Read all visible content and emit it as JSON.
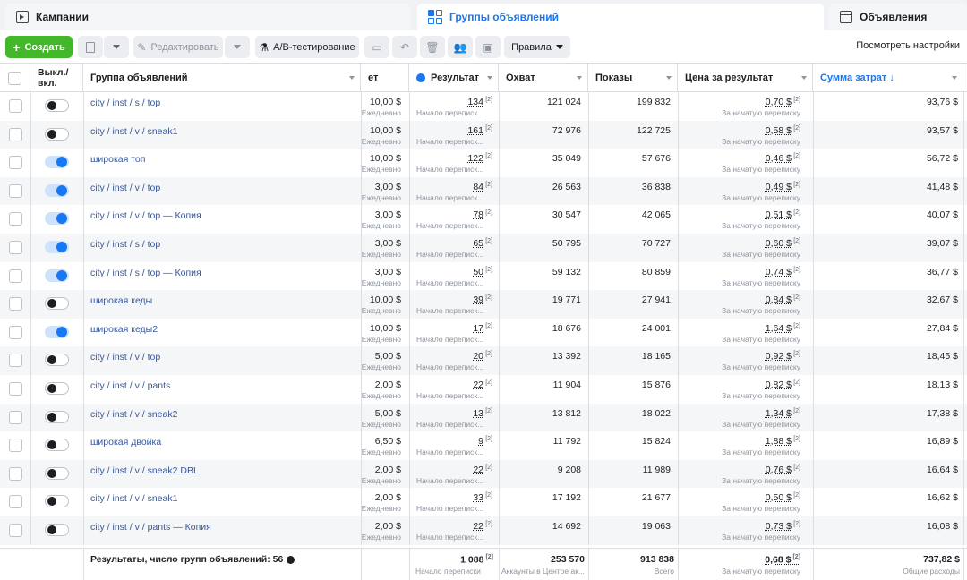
{
  "tabs": [
    {
      "label": "Кампании"
    },
    {
      "label": "Группы объявлений"
    },
    {
      "label": "Объявления"
    }
  ],
  "toolbar": {
    "create_label": "Создать",
    "edit_label": "Редактировать",
    "ab_label": "A/B-тестирование",
    "rules_label": "Правила",
    "settings_label": "Посмотреть настройки"
  },
  "columns": {
    "toggle": "Выкл./ вкл.",
    "name": "Группа объявлений",
    "budget": "ет",
    "result": "Результат",
    "reach": "Охват",
    "impressions": "Показы",
    "cost_per_result": "Цена за результат",
    "spend": "Сумма затрат ↓"
  },
  "rows": [
    {
      "on": false,
      "name": "city / inst / s / top",
      "budget": "10,00 $",
      "budget_sub": "Ежедневно",
      "result": "134",
      "result_sub": "Начало переписк...",
      "reach": "121 024",
      "impressions": "199 832",
      "cpr": "0,70 $",
      "cpr_sub": "За начатую переписку",
      "spend": "93,76 $"
    },
    {
      "on": false,
      "name": "city / inst / v / sneak1",
      "budget": "10,00 $",
      "budget_sub": "Ежедневно",
      "result": "161",
      "result_sub": "Начало переписк...",
      "reach": "72 976",
      "impressions": "122 725",
      "cpr": "0,58 $",
      "cpr_sub": "За начатую переписку",
      "spend": "93,57 $"
    },
    {
      "on": true,
      "name": "широкая топ",
      "budget": "10,00 $",
      "budget_sub": "Ежедневно",
      "result": "122",
      "result_sub": "Начало переписк...",
      "reach": "35 049",
      "impressions": "57 676",
      "cpr": "0,46 $",
      "cpr_sub": "За начатую переписку",
      "spend": "56,72 $"
    },
    {
      "on": true,
      "name": "city / inst / v / top",
      "budget": "3,00 $",
      "budget_sub": "Ежедневно",
      "result": "84",
      "result_sub": "Начало переписк...",
      "reach": "26 563",
      "impressions": "36 838",
      "cpr": "0,49 $",
      "cpr_sub": "За начатую переписку",
      "spend": "41,48 $"
    },
    {
      "on": true,
      "name": "city / inst / v / top — Копия",
      "budget": "3,00 $",
      "budget_sub": "Ежедневно",
      "result": "78",
      "result_sub": "Начало переписк...",
      "reach": "30 547",
      "impressions": "42 065",
      "cpr": "0,51 $",
      "cpr_sub": "За начатую переписку",
      "spend": "40,07 $"
    },
    {
      "on": true,
      "name": "city / inst / s / top",
      "budget": "3,00 $",
      "budget_sub": "Ежедневно",
      "result": "65",
      "result_sub": "Начало переписк...",
      "reach": "50 795",
      "impressions": "70 727",
      "cpr": "0,60 $",
      "cpr_sub": "За начатую переписку",
      "spend": "39,07 $"
    },
    {
      "on": true,
      "name": "city / inst / s / top — Копия",
      "budget": "3,00 $",
      "budget_sub": "Ежедневно",
      "result": "50",
      "result_sub": "Начало переписк...",
      "reach": "59 132",
      "impressions": "80 859",
      "cpr": "0,74 $",
      "cpr_sub": "За начатую переписку",
      "spend": "36,77 $"
    },
    {
      "on": false,
      "name": "широкая кеды",
      "budget": "10,00 $",
      "budget_sub": "Ежедневно",
      "result": "39",
      "result_sub": "Начало переписк...",
      "reach": "19 771",
      "impressions": "27 941",
      "cpr": "0,84 $",
      "cpr_sub": "За начатую переписку",
      "spend": "32,67 $"
    },
    {
      "on": true,
      "name": "широкая кеды2",
      "budget": "10,00 $",
      "budget_sub": "Ежедневно",
      "result": "17",
      "result_sub": "Начало переписк...",
      "reach": "18 676",
      "impressions": "24 001",
      "cpr": "1,64 $",
      "cpr_sub": "За начатую переписку",
      "spend": "27,84 $"
    },
    {
      "on": false,
      "name": "city / inst / v / top",
      "budget": "5,00 $",
      "budget_sub": "Ежедневно",
      "result": "20",
      "result_sub": "Начало переписк...",
      "reach": "13 392",
      "impressions": "18 165",
      "cpr": "0,92 $",
      "cpr_sub": "За начатую переписку",
      "spend": "18,45 $"
    },
    {
      "on": false,
      "name": "city / inst / v / pants",
      "budget": "2,00 $",
      "budget_sub": "Ежедневно",
      "result": "22",
      "result_sub": "Начало переписк...",
      "reach": "11 904",
      "impressions": "15 876",
      "cpr": "0,82 $",
      "cpr_sub": "За начатую переписку",
      "spend": "18,13 $"
    },
    {
      "on": false,
      "name": "city / inst / v / sneak2",
      "budget": "5,00 $",
      "budget_sub": "Ежедневно",
      "result": "13",
      "result_sub": "Начало переписк...",
      "reach": "13 812",
      "impressions": "18 022",
      "cpr": "1,34 $",
      "cpr_sub": "За начатую переписку",
      "spend": "17,38 $"
    },
    {
      "on": false,
      "name": "широкая двойка",
      "budget": "6,50 $",
      "budget_sub": "Ежедневно",
      "result": "9",
      "result_sub": "Начало переписк...",
      "reach": "11 792",
      "impressions": "15 824",
      "cpr": "1,88 $",
      "cpr_sub": "За начатую переписку",
      "spend": "16,89 $"
    },
    {
      "on": false,
      "name": "city / inst / v / sneak2 DBL",
      "budget": "2,00 $",
      "budget_sub": "Ежедневно",
      "result": "22",
      "result_sub": "Начало переписк...",
      "reach": "9 208",
      "impressions": "11 989",
      "cpr": "0,76 $",
      "cpr_sub": "За начатую переписку",
      "spend": "16,64 $"
    },
    {
      "on": false,
      "name": "city / inst / v / sneak1",
      "budget": "2,00 $",
      "budget_sub": "Ежедневно",
      "result": "33",
      "result_sub": "Начало переписк...",
      "reach": "17 192",
      "impressions": "21 677",
      "cpr": "0,50 $",
      "cpr_sub": "За начатую переписку",
      "spend": "16,62 $"
    },
    {
      "on": false,
      "name": "city / inst / v / pants — Копия",
      "budget": "2,00 $",
      "budget_sub": "Ежедневно",
      "result": "22",
      "result_sub": "Начало переписк...",
      "reach": "14 692",
      "impressions": "19 063",
      "cpr": "0,73 $",
      "cpr_sub": "За начатую переписку",
      "spend": "16,08 $"
    }
  ],
  "footer": {
    "label": "Результаты, число групп объявлений: 56",
    "result": "1 088",
    "result_sub": "Начало переписки",
    "reach": "253 570",
    "reach_sub": "Аккаунты в Центре ак...",
    "impressions": "913 838",
    "impressions_sub": "Всего",
    "cpr": "0,68 $",
    "cpr_sub": "За начатую переписку",
    "spend": "737,82 $",
    "spend_sub": "Общие расходы"
  },
  "colors": {
    "accent": "#1877f2",
    "create": "#42b72a",
    "link": "#385898"
  }
}
